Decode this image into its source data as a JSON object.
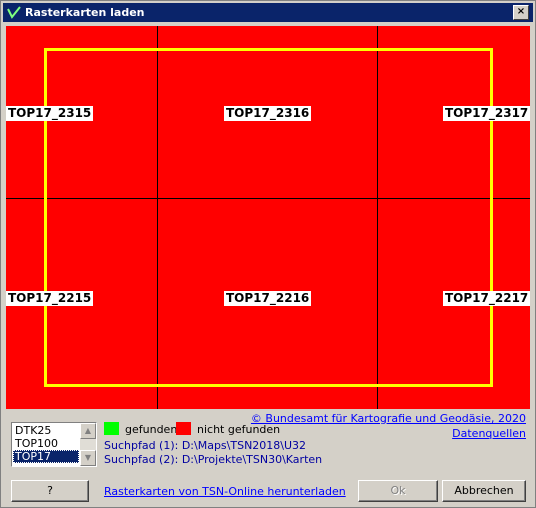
{
  "window": {
    "title": "Rasterkarten laden",
    "close_label": "×"
  },
  "map": {
    "colors": {
      "background": "#ff0000",
      "frame": "#ffff00",
      "grid": "#000000"
    },
    "tiles": [
      {
        "label": "TOP17_2315"
      },
      {
        "label": "TOP17_2316"
      },
      {
        "label": "TOP17_2317"
      },
      {
        "label": "TOP17_2215"
      },
      {
        "label": "TOP17_2216"
      },
      {
        "label": "TOP17_2217"
      }
    ]
  },
  "map_types": {
    "items": [
      "DTK25",
      "TOP100",
      "TOP17"
    ],
    "selected": "TOP17"
  },
  "legend": {
    "found_label": "gefunden",
    "found_color": "#00ff00",
    "not_found_label": "nicht gefunden",
    "not_found_color": "#ff0000"
  },
  "paths": {
    "path1": "Suchpfad (1): D:\\Maps\\TSN2018\\U32",
    "path2": "Suchpfad (2): D:\\Projekte\\TSN30\\Karten"
  },
  "links": {
    "copyright": "© Bundesamt für Kartografie und Geodäsie, 2020",
    "data_sources": "Datenquellen",
    "download": "Rasterkarten von TSN-Online herunterladen"
  },
  "buttons": {
    "help": "?",
    "ok": "Ok",
    "cancel": "Abbrechen"
  }
}
